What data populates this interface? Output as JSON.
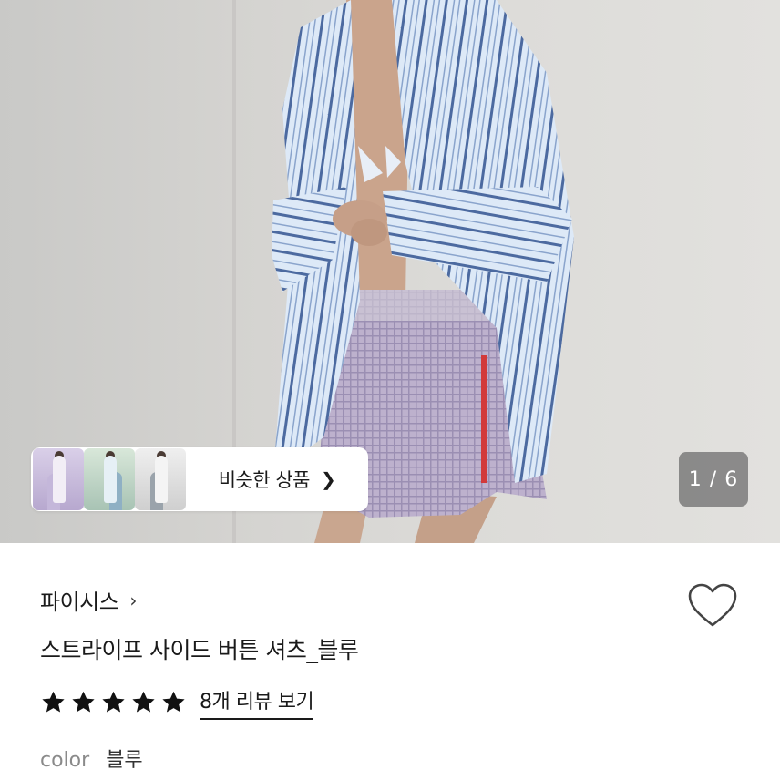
{
  "product_image": {
    "description_icon": "model-photo",
    "counter": "1 / 6"
  },
  "similar_products": {
    "label": "비슷한 상품",
    "thumbnails": [
      "thumb-1",
      "thumb-2",
      "thumb-3"
    ]
  },
  "product": {
    "brand": "파이시스",
    "title": "스트라이프 사이드 버튼 셔츠_블루",
    "rating_stars": 5,
    "review_link": "8개 리뷰 보기",
    "color_label": "color",
    "color_value": "블루"
  },
  "colors": {
    "star": "#111111",
    "counter_bg": "#6e6e6e",
    "shirt_stripe": "#3f5f95",
    "shirt_base": "#d8e6f6",
    "shorts": "#b5a8c6"
  }
}
